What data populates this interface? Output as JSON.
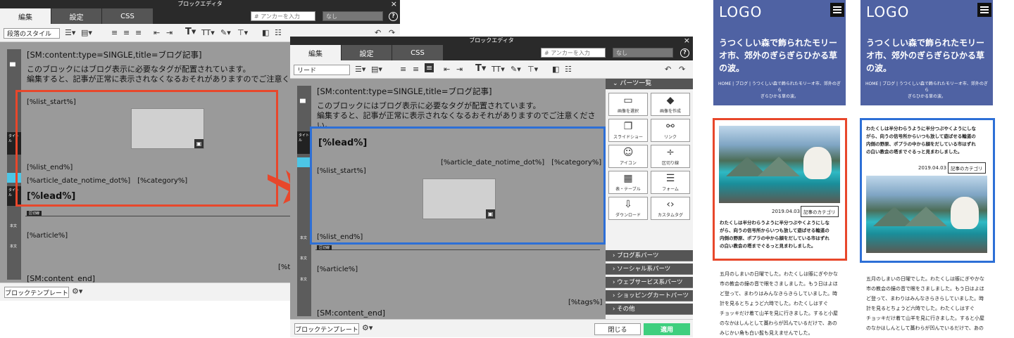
{
  "left_editor": {
    "title": "ブロックエディタ",
    "tabs": [
      "編集",
      "設定",
      "CSS"
    ],
    "anchor_placeholder": "# アンカーを入力",
    "nasi": "なし",
    "style_select": "段落のスタイル",
    "content_tag": "[SM:content:type=SINGLE,title=ブログ記事]",
    "notice_line1": "このブロックにはブログ表示に必要なタグが配置されています。",
    "notice_line2": "編集すると、記事が正常に表示されなくなるおそれがありますのでご注意くだ",
    "list_start": "[%list_start%]",
    "list_end": "[%list_end%]",
    "date_cat": "[%article_date_notime_dot%]　[%category%]",
    "lead": "[%lead%]",
    "separator_label": "区切線",
    "article": "[%article%]",
    "tags_partial": "[%ta",
    "content_end": "[SM:content_end]",
    "block_template": "ブロックテンプレート",
    "gutter_title": "タイトル",
    "gutter_body": "本文"
  },
  "right_editor": {
    "title": "ブロックエディタ",
    "tabs": [
      "編集",
      "設定",
      "CSS"
    ],
    "anchor_placeholder": "# アンカーを入力",
    "nasi": "なし",
    "style_select": "リード",
    "content_tag": "[SM:content:type=SINGLE,title=ブログ記事]",
    "notice_line1": "このブロックにはブログ表示に必要なタグが配置されています。",
    "notice_line2": "編集すると、記事が正常に表示されなくなるおそれがありますのでご注意くださ",
    "notice_line3": "い。",
    "lead": "[%lead%]",
    "date_cat": "[%article_date_notime_dot%]　[%category%]",
    "list_start": "[%list_start%]",
    "list_end": "[%list_end%]",
    "separator_label": "区切線",
    "article": "[%article%]",
    "tags": "[%tags%]",
    "content_end": "[SM:content_end]",
    "block_template": "ブロックテンプレート",
    "close": "閉じる",
    "apply": "適用",
    "gutter_title": "タイトル",
    "gutter_body": "本文",
    "parts_head": "パーツ一覧",
    "parts": [
      {
        "icon": "▭",
        "label": "画像を選択"
      },
      {
        "icon": "◆",
        "label": "画像を作成"
      },
      {
        "icon": "❐",
        "label": "スライドショー"
      },
      {
        "icon": "⚯",
        "label": "リンク"
      },
      {
        "icon": "☺",
        "label": "アイコン"
      },
      {
        "icon": "÷",
        "label": "区切り線"
      },
      {
        "icon": "▦",
        "label": "表・テーブル"
      },
      {
        "icon": "☰",
        "label": "フォーム"
      },
      {
        "icon": "⇩",
        "label": "ダウンロード"
      },
      {
        "icon": "‹›",
        "label": "カスタムタグ"
      }
    ],
    "categories": [
      "ブログ系パーツ",
      "ソーシャル系パーツ",
      "ウェブサービス系パーツ",
      "ショッピングカートパーツ",
      "その他"
    ]
  },
  "preview": {
    "logo": "LOGO",
    "title_line1": "うつくしい森で飾られたモリー",
    "title_line2": "オ市、郊外のぎらぎらひかる草",
    "title_line3": "の波。",
    "breadcrumb_line1": "HOME | ブログ | うつくしい森で飾られたモリーオ市、郊外のぎら",
    "breadcrumb_line2": "ぎらひかる草の波。",
    "date": "2019.04.03",
    "category": "記事のカテゴリ",
    "lead_lines": [
      "わたくしは半分わらうように半分つぶやくようにしな",
      "がら、向うの信号所からいつも放して遊ばせる輪道の",
      "内側の野原、ポプラの中から顔をだしている市はずれ",
      "の白い教会の塔までぐるっと見まわしました。"
    ],
    "article_lines": [
      "五月のしまいの日曜でした。わたくしは賑にぎやかな",
      "市の教会の鐘の音で眼をさましました。もう日はよほ",
      "ど登って、まわりはみんなきらきらしていました。時",
      "計を見るとちょうど六時でした。わたくしはすぐ",
      "チョッキだけ着て山羊を見に行きました。すると小屋",
      "のなかはしんとして藁わらが凹んでいるだけで、あの",
      "みじかい角も白い髭も見えませんでした。"
    ]
  },
  "colors": {
    "red_highlight": "#e8472b",
    "blue_highlight": "#2d6fd6",
    "header_blue": "#4f62a3",
    "apply_green": "#3ecf7e"
  }
}
